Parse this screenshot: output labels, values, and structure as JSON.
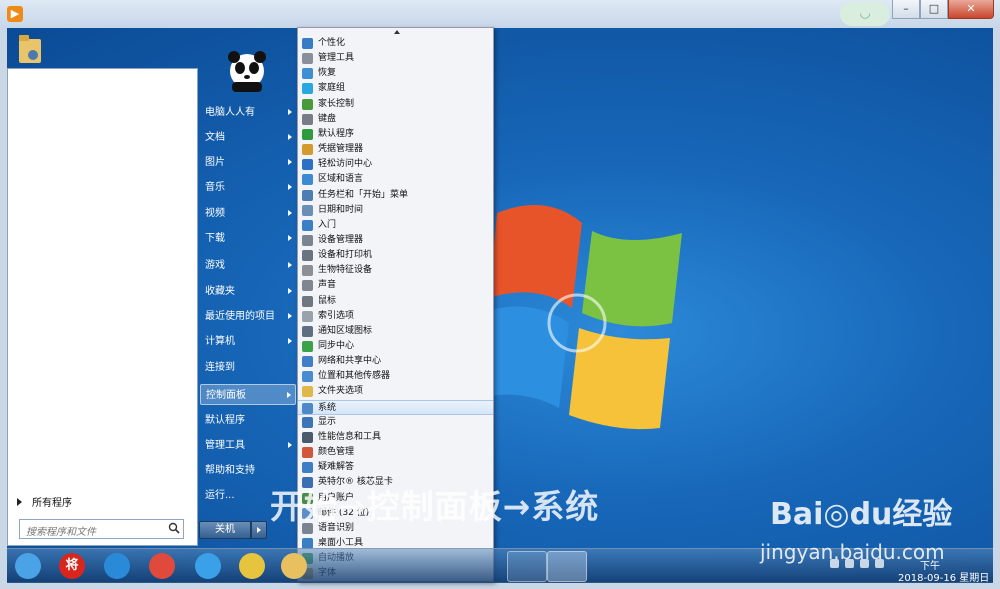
{
  "window": {
    "icon": "video-app-icon",
    "ghost_label": "◡",
    "buttons": {
      "minimize": "–",
      "maximize": "□",
      "close": "✕"
    }
  },
  "start_menu": {
    "search": {
      "placeholder": "搜索程序和文件"
    },
    "all_programs": "所有程序",
    "right_items": [
      {
        "label": "电脑人人有",
        "arrow": true
      },
      {
        "label": "文档",
        "arrow": true
      },
      {
        "label": "图片",
        "arrow": true
      },
      {
        "label": "音乐",
        "arrow": true
      },
      {
        "label": "视频",
        "arrow": true
      },
      {
        "label": "下载",
        "arrow": true
      },
      {
        "label": "游戏",
        "arrow": true
      },
      {
        "label": "收藏夹",
        "arrow": true
      },
      {
        "label": "最近使用的项目",
        "arrow": true
      },
      {
        "label": "计算机",
        "arrow": true
      },
      {
        "label": "连接到",
        "arrow": false
      },
      {
        "label": "控制面板",
        "arrow": true,
        "selected": true
      },
      {
        "label": "默认程序",
        "arrow": false
      },
      {
        "label": "管理工具",
        "arrow": true
      },
      {
        "label": "帮助和支持",
        "arrow": false
      },
      {
        "label": "运行...",
        "arrow": false
      }
    ],
    "shutdown": "关机"
  },
  "control_panel_items": [
    {
      "label": "个性化",
      "icon": "personalize-icon",
      "color": "#3a7bc8"
    },
    {
      "label": "管理工具",
      "icon": "admin-tools-icon",
      "color": "#8a8f99"
    },
    {
      "label": "恢复",
      "icon": "recovery-icon",
      "color": "#3f8fd2"
    },
    {
      "label": "家庭组",
      "icon": "homegroup-icon",
      "color": "#2aa6e0"
    },
    {
      "label": "家长控制",
      "icon": "parental-icon",
      "color": "#4a9a3a"
    },
    {
      "label": "键盘",
      "icon": "keyboard-icon",
      "color": "#777c85"
    },
    {
      "label": "默认程序",
      "icon": "default-programs-icon",
      "color": "#2f9b3e"
    },
    {
      "label": "凭据管理器",
      "icon": "credential-icon",
      "color": "#d49a2b"
    },
    {
      "label": "轻松访问中心",
      "icon": "ease-access-icon",
      "color": "#2d6fc4"
    },
    {
      "label": "区域和语言",
      "icon": "region-icon",
      "color": "#3c8bd0"
    },
    {
      "label": "任务栏和「开始」菜单",
      "icon": "taskbar-icon",
      "color": "#4d7db5"
    },
    {
      "label": "日期和时间",
      "icon": "datetime-icon",
      "color": "#6a8fb5"
    },
    {
      "label": "入门",
      "icon": "getting-started-icon",
      "color": "#3b7fc8"
    },
    {
      "label": "设备管理器",
      "icon": "device-manager-icon",
      "color": "#7b8491"
    },
    {
      "label": "设备和打印机",
      "icon": "printer-icon",
      "color": "#6b7380"
    },
    {
      "label": "生物特征设备",
      "icon": "biometric-icon",
      "color": "#8c8f96"
    },
    {
      "label": "声音",
      "icon": "sound-icon",
      "color": "#808791"
    },
    {
      "label": "鼠标",
      "icon": "mouse-icon",
      "color": "#6f7680"
    },
    {
      "label": "索引选项",
      "icon": "index-icon",
      "color": "#9aa1ab"
    },
    {
      "label": "通知区域图标",
      "icon": "notification-icon",
      "color": "#5f6f82"
    },
    {
      "label": "同步中心",
      "icon": "sync-icon",
      "color": "#3aa24a"
    },
    {
      "label": "网络和共享中心",
      "icon": "network-icon",
      "color": "#3f7fc8"
    },
    {
      "label": "位置和其他传感器",
      "icon": "location-icon",
      "color": "#4a8ad0"
    },
    {
      "label": "文件夹选项",
      "icon": "folder-options-icon",
      "color": "#e0b84a"
    },
    {
      "label": "系统",
      "icon": "system-icon",
      "color": "#4f88c8",
      "hover": true
    },
    {
      "label": "显示",
      "icon": "display-icon",
      "color": "#3c74b8"
    },
    {
      "label": "性能信息和工具",
      "icon": "performance-icon",
      "color": "#4a5a6c"
    },
    {
      "label": "颜色管理",
      "icon": "color-icon",
      "color": "#d2563c"
    },
    {
      "label": "疑难解答",
      "icon": "troubleshoot-icon",
      "color": "#3e7ec4"
    },
    {
      "label": "英特尔® 核芯显卡",
      "icon": "intel-graphics-icon",
      "color": "#3b6fb0"
    },
    {
      "label": "用户账户",
      "icon": "user-accounts-icon",
      "color": "#4a8a4a"
    },
    {
      "label": "邮件 (32 位)",
      "icon": "mail-icon",
      "color": "#5a8fc8"
    },
    {
      "label": "语音识别",
      "icon": "speech-icon",
      "color": "#7b8490"
    },
    {
      "label": "桌面小工具",
      "icon": "gadgets-icon",
      "color": "#3a7fc4"
    },
    {
      "label": "自动播放",
      "icon": "autoplay-icon",
      "color": "#3a9a4a"
    },
    {
      "label": "字体",
      "icon": "font-icon",
      "color": "#d0a040"
    }
  ],
  "taskbar": {
    "icons": [
      {
        "name": "start-orb-icon",
        "color": "#4aa3e6"
      },
      {
        "name": "app-jiang-icon",
        "color": "#d8261c",
        "label": "将"
      },
      {
        "name": "ie-icon",
        "color": "#2b8ad8"
      },
      {
        "name": "chrome-icon",
        "color": "#e04a3c"
      },
      {
        "name": "cloud-icon",
        "color": "#3aa0e8"
      },
      {
        "name": "sticky-notes-icon",
        "color": "#e6c43e"
      },
      {
        "name": "folder-icon",
        "color": "#e8c060"
      }
    ],
    "date": "2018-09-16 星期日",
    "time": "下午"
  },
  "caption": "开始→控制面板→系统",
  "watermark": {
    "brand": "Bai◎du经验",
    "url": "jingyan.baidu.com"
  }
}
